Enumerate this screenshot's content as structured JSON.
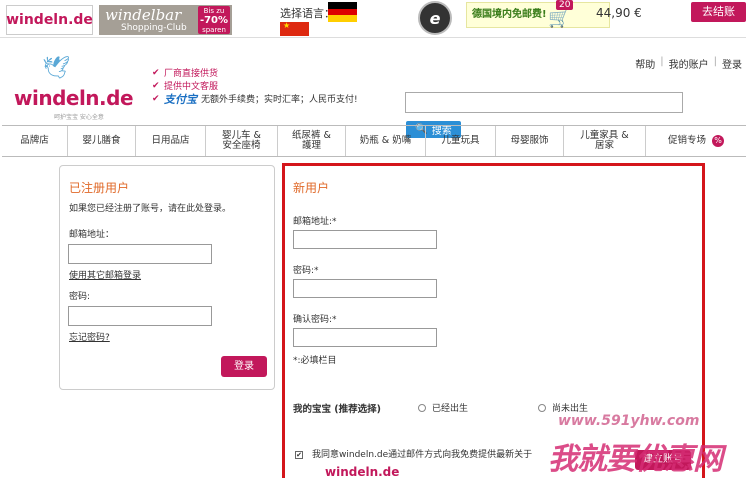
{
  "topbar": {
    "windeln_logo": "windeln.de",
    "windelbar": {
      "name": "windelbar",
      "sub": "Shopping-Club",
      "badge_line1": "Bis zu",
      "badge_pct": "-70%",
      "badge_line2": "sparen"
    },
    "lang_label": "选择语言：",
    "trusted_mark": "e",
    "shipping_text": "德国境内免邮费!",
    "cart_count": "20",
    "cart_total": "44,90 €",
    "checkout_label": "去结账"
  },
  "header": {
    "logo_wordmark": "windeln.de",
    "logo_tagline": "呵护宝宝 安心全意",
    "benefits": [
      "厂商直接供货",
      "提供中文客服"
    ],
    "alipay": "支付宝",
    "alipay_text": "无额外手续费；实时汇率；人民币支付!",
    "toplinks": [
      "帮助",
      "我的账户",
      "登录"
    ],
    "search_value": "",
    "search_button": "搜索"
  },
  "nav": {
    "items": [
      "品牌店",
      "婴儿膳食",
      "日用品店",
      "婴儿车 & 安全座椅",
      "纸尿裤 & 護理",
      "奶瓶 & 奶嘴",
      "儿童玩具",
      "母婴服饰",
      "儿童家具 & 居家",
      "促销专场"
    ],
    "sale_badge": "%"
  },
  "login": {
    "title": "已注册用户",
    "hint": "如果您已经注册了账号，请在此处登录。",
    "email_label": "邮箱地址：",
    "email_value": "",
    "other_email_link": "使用其它邮箱登录",
    "password_label": "密码:",
    "password_value": "",
    "forgot_link": "忘记密码?",
    "submit": "登录"
  },
  "register": {
    "title": "新用户",
    "email_label": "邮箱地址:*",
    "password_label": "密码:*",
    "confirm_label": "确认密码:*",
    "required_note": "*:必填栏目",
    "baby_label": "我的宝宝 (推荐选择)",
    "baby_options": [
      "已经出生",
      "尚未出生"
    ],
    "newsletter_text": "我同意windeln.de通过邮件方式向我免费提供最新关于",
    "newsletter_logo": "windeln.de",
    "newsletter_checked": true,
    "submit": "建立账号"
  },
  "watermark": {
    "url": "www.591yhw.com",
    "text": "我就要优惠网"
  },
  "colors": {
    "brand": "#c2185b",
    "title_orange": "#e06a2a",
    "highlight_red": "#d4161b",
    "search_blue": "#2c8fd6"
  }
}
